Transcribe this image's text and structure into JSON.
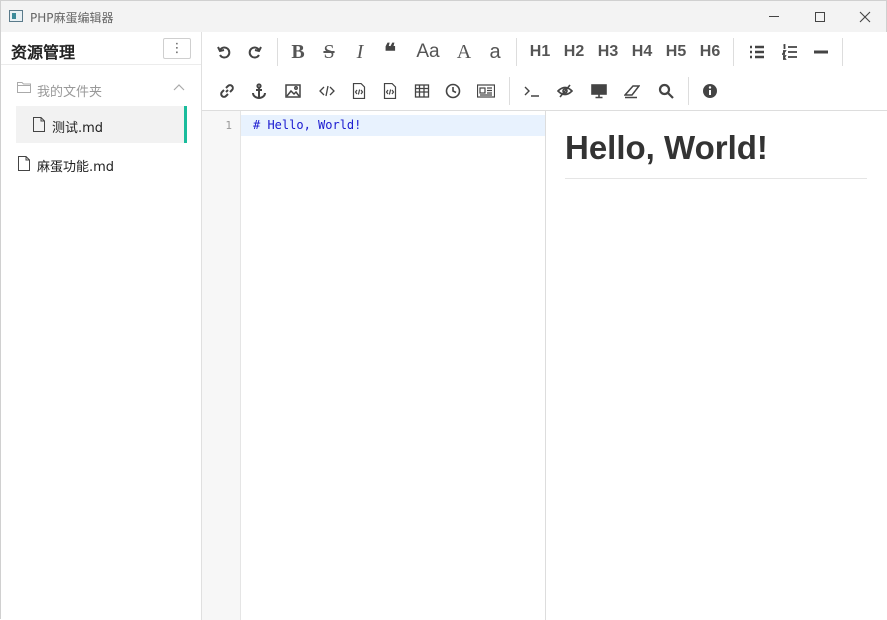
{
  "window": {
    "title": "PHP麻蛋编辑器"
  },
  "sidebar": {
    "title": "资源管理",
    "more_label": "⋮",
    "folder": {
      "label": "我的文件夹",
      "expanded": true
    },
    "files": [
      {
        "label": "测试.md",
        "active": true
      },
      {
        "label": "麻蛋功能.md",
        "active": false
      }
    ],
    "accent_color": "#1abc9c"
  },
  "toolbar": {
    "row1": [
      {
        "icon": "undo-icon"
      },
      {
        "icon": "redo-icon"
      },
      {
        "icon": "bold-icon",
        "label": "B"
      },
      {
        "icon": "strikethrough-icon",
        "label": "S"
      },
      {
        "icon": "italic-icon",
        "label": "I"
      },
      {
        "icon": "quote-icon",
        "label": "❝"
      },
      {
        "icon": "uppercase-icon",
        "label": "Aa"
      },
      {
        "icon": "uppercase-first-icon",
        "label": "A"
      },
      {
        "icon": "lowercase-icon",
        "label": "a"
      },
      {
        "icon": "h1-icon",
        "label": "H1"
      },
      {
        "icon": "h2-icon",
        "label": "H2"
      },
      {
        "icon": "h3-icon",
        "label": "H3"
      },
      {
        "icon": "h4-icon",
        "label": "H4"
      },
      {
        "icon": "h5-icon",
        "label": "H5"
      },
      {
        "icon": "h6-icon",
        "label": "H6"
      },
      {
        "icon": "unordered-list-icon"
      },
      {
        "icon": "ordered-list-icon"
      },
      {
        "icon": "horizontal-rule-icon"
      }
    ],
    "row2": [
      {
        "icon": "link-icon"
      },
      {
        "icon": "anchor-icon"
      },
      {
        "icon": "image-icon"
      },
      {
        "icon": "code-inline-icon"
      },
      {
        "icon": "code-block-icon"
      },
      {
        "icon": "code-file-icon"
      },
      {
        "icon": "table-icon"
      },
      {
        "icon": "datetime-icon"
      },
      {
        "icon": "html-entities-icon"
      },
      {
        "icon": "terminal-icon"
      },
      {
        "icon": "preview-hide-icon"
      },
      {
        "icon": "fullscreen-preview-icon"
      },
      {
        "icon": "clear-icon"
      },
      {
        "icon": "search-icon"
      },
      {
        "icon": "info-icon"
      }
    ]
  },
  "editor": {
    "lines": [
      {
        "number": "1",
        "text": "# Hello, World!"
      }
    ],
    "syntax_color": "#1a1ad0",
    "active_line_color": "#e8f2fe"
  },
  "preview": {
    "heading": "Hello, World!"
  }
}
